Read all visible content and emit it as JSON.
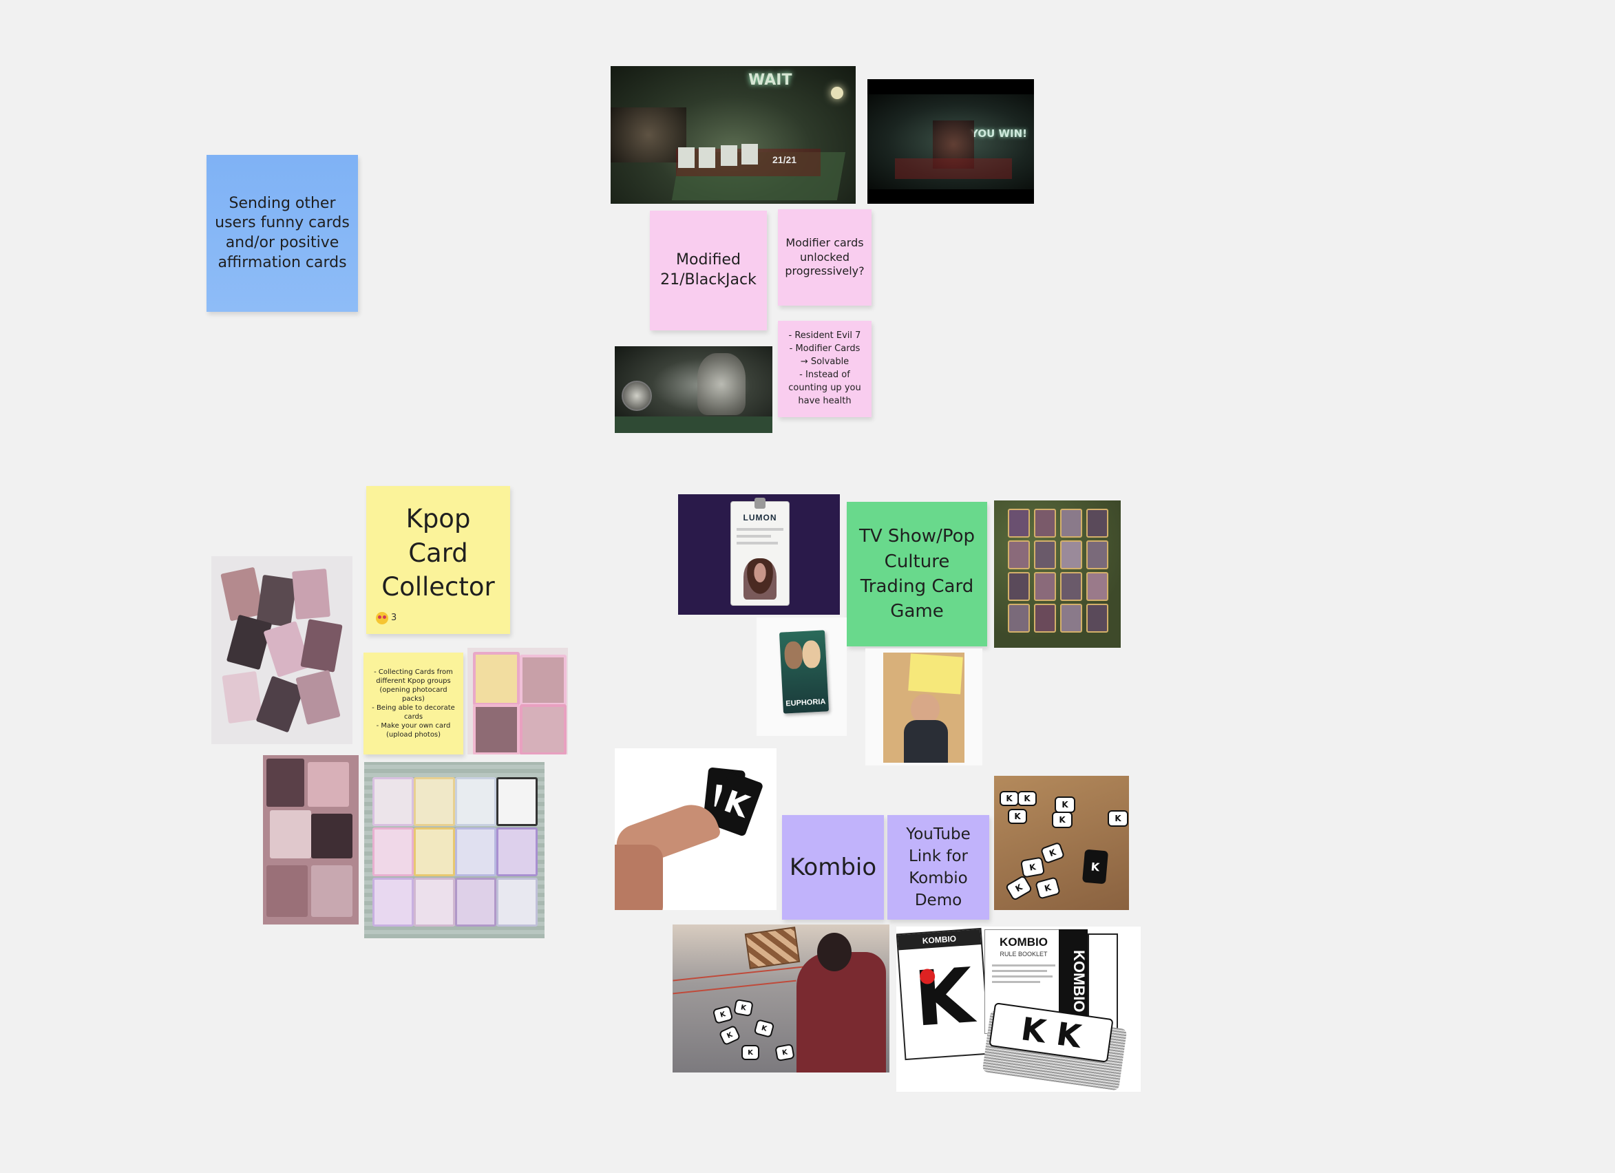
{
  "notes": {
    "sending_cards": "Sending other users funny cards and/or positive affirmation cards",
    "modified_blackjack": "Modified 21/BlackJack",
    "modifier_unlocked": "Modifier cards unlocked progressively?",
    "re7_notes": "- Resident Evil 7\n- Modifier Cards\n→ Solvable\n- Instead of counting up you have health",
    "kpop_title": "Kpop Card Collector",
    "kpop_reaction_count": "3",
    "kpop_details": "- Collecting Cards from different Kpop groups (opening photocard packs)\n- Being able to decorate cards\n- Make your own card (upload photos)",
    "tv_show": "TV Show/Pop Culture Trading Card Game",
    "kombio": "Kombio",
    "youtube_link": "YouTube Link for Kombio Demo"
  },
  "images": {
    "re7_wait_text": "WAIT",
    "re7_score_text": "21/21",
    "re7_youwin_text": "YOU WIN!",
    "lumon_logo": "LUMON",
    "euphoria_title": "EUPHORIA",
    "kombio_box_title": "KOMBIO",
    "kombio_booklet": "KOMBIO",
    "kombio_booklet_sub": "RULE BOOKLET",
    "kombio_side": "KOMBIO"
  },
  "colors": {
    "canvas": "#f1f1f1",
    "blue_note": "#8ebcf7",
    "pink_note": "#f9cdef",
    "yellow_note": "#fbf39a",
    "green_note": "#69d98c",
    "purple_note": "#c1b3fb"
  }
}
